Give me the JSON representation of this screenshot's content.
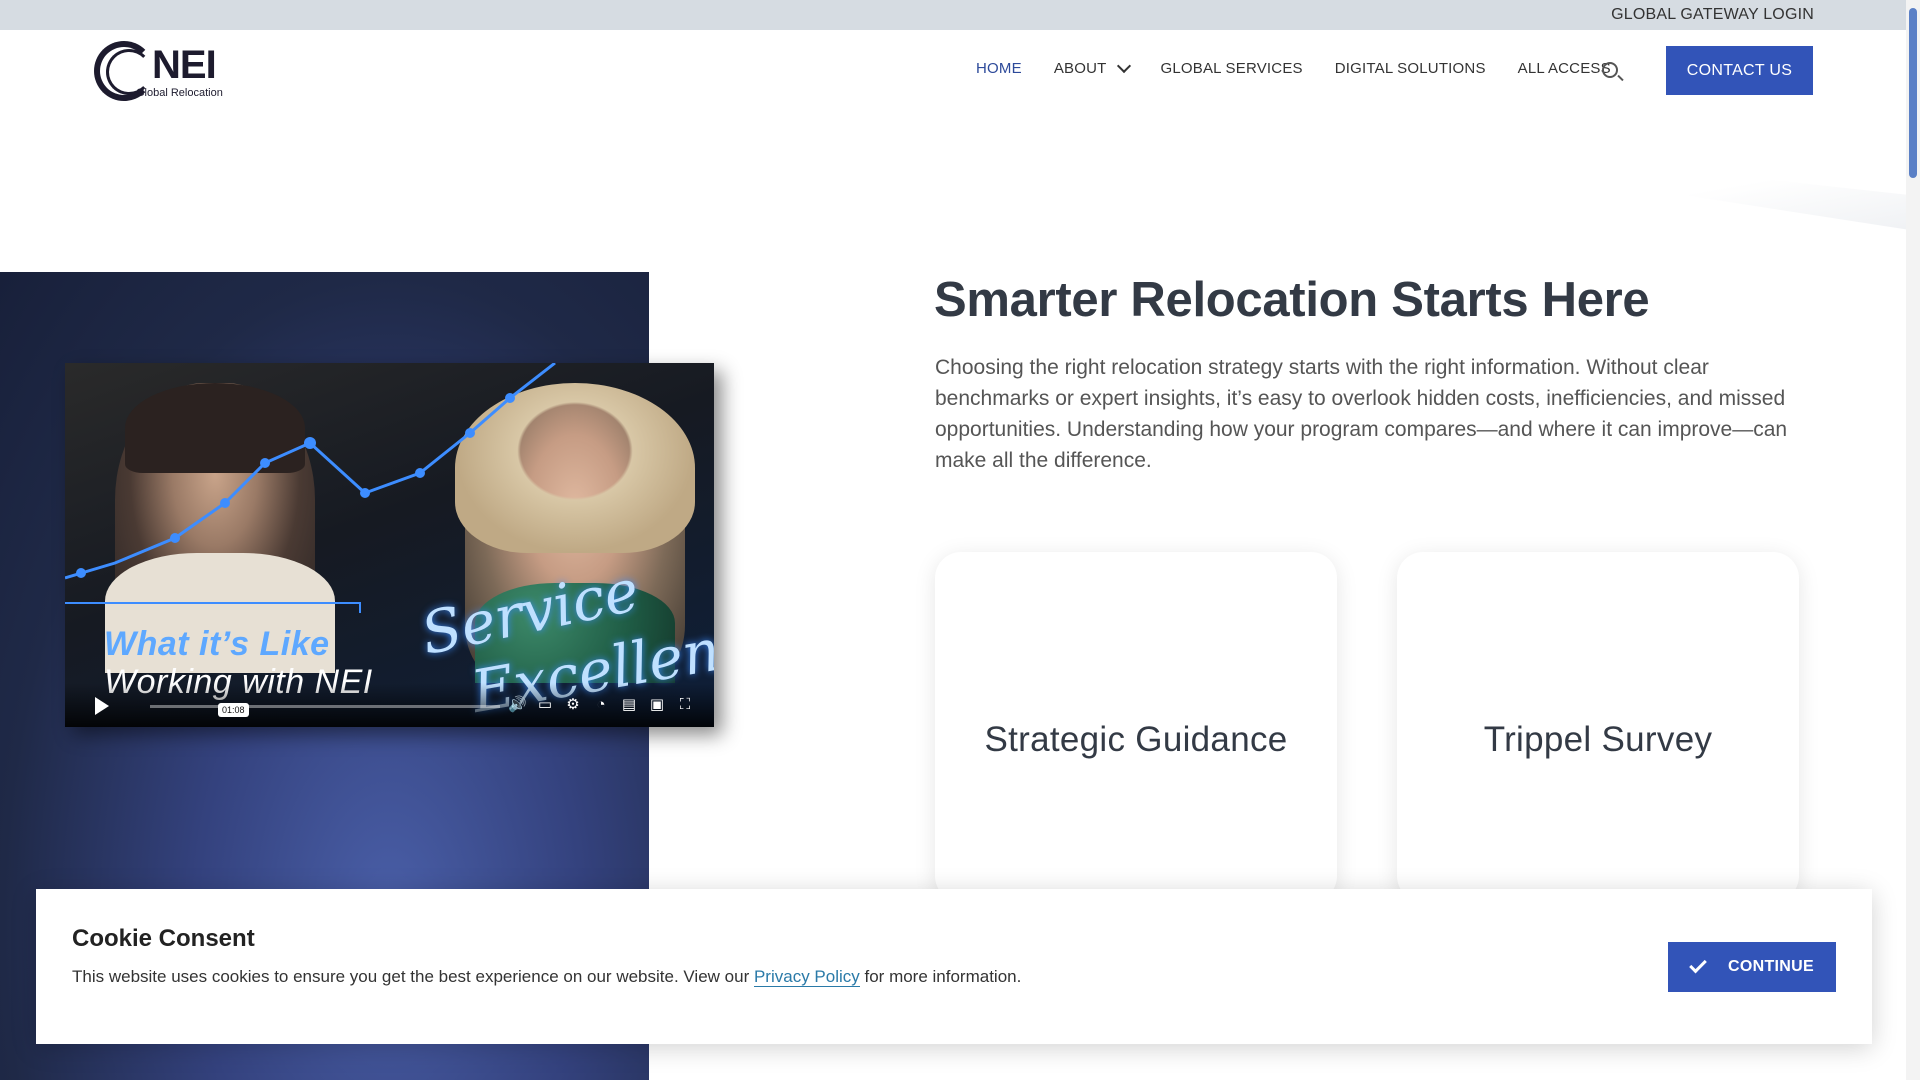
{
  "topbar": {
    "login_label": "GLOBAL GATEWAY LOGIN"
  },
  "header": {
    "logo_text": "NEI",
    "logo_subtext": "Global Relocation",
    "nav": [
      {
        "label": "HOME",
        "active": true
      },
      {
        "label": "ABOUT",
        "has_dropdown": true
      },
      {
        "label": "GLOBAL SERVICES"
      },
      {
        "label": "DIGITAL SOLUTIONS"
      },
      {
        "label": "ALL ACCESS"
      }
    ],
    "search_icon": "search-icon",
    "contact_label": "CONTACT US"
  },
  "video": {
    "tagline_line1": "What it’s Like",
    "tagline_line2": "Working with NEI",
    "script_line1": "Service",
    "script_line2": "Excellence",
    "time_tooltip": "01:08"
  },
  "hero": {
    "title": "Smarter Relocation Starts Here",
    "body": "Choosing the right relocation strategy starts with the right information. Without clear benchmarks or expert insights, it’s easy to overlook hidden costs, inefficiencies, and missed opportunities. Understanding how your program compares—and where it can improve—can make all the difference."
  },
  "cards": [
    {
      "label": "Strategic Guidance"
    },
    {
      "label": "Trippel Survey"
    }
  ],
  "cookie": {
    "title": "Cookie Consent",
    "text_before": "This website uses cookies to ensure you get the best experience on our website. View our ",
    "link_text": "Privacy Policy",
    "text_after": " for more information.",
    "continue_label": "CONTINUE"
  },
  "colors": {
    "accent": "#3254b8",
    "nav_active": "#2d4a9a",
    "topbar_bg": "#d6dce2",
    "link": "#2a7aa8"
  }
}
